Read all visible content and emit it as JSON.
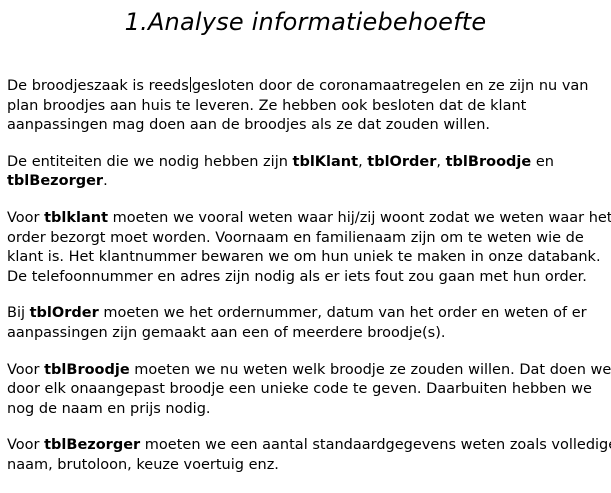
{
  "heading": "1.Analyse informatiebehoefte",
  "p1": {
    "l1_before_cursor": "De broodjeszaak is reeds",
    "l1_after_cursor": "gesloten door de coronamaatregelen en ze zijn nu van",
    "l2": "plan broodjes aan huis te leveren. Ze hebben ook besloten dat de klant",
    "l3": "aanpassingen mag doen aan de broodjes als ze dat zouden willen."
  },
  "p2": {
    "t1": "De entiteiten die we nodig hebben zijn ",
    "e1": "tblKlant",
    "t2": ", ",
    "e2": "tblOrder",
    "t3": ", ",
    "e3": "tblBroodje",
    "t4": " en",
    "e4": "tblBezorger",
    "t5": "."
  },
  "p3": {
    "t1": "Voor ",
    "e1": "tblklant",
    "t2": " moeten we vooral weten waar hij/zij woont zodat we weten waar het",
    "l2": "order bezorgt moet worden. Voornaam en familienaam zijn om te weten wie de",
    "l3": "klant is. Het klantnummer bewaren we om hun uniek te maken in onze databank.",
    "l4": "De telefoonnummer en adres zijn nodig als er iets fout zou gaan met hun order."
  },
  "p4": {
    "t1": "Bij ",
    "e1": "tblOrder",
    "t2": " moeten we het ordernummer, datum van het order en weten of er",
    "l2": "aanpassingen zijn gemaakt aan een of meerdere broodje(s)."
  },
  "p5": {
    "t1": "Voor ",
    "e1": "tblBroodje",
    "t2": " moeten we nu weten welk broodje ze zouden willen. Dat doen we",
    "l2": "door elk onaangepast broodje een unieke code te geven. Daarbuiten hebben we",
    "l3": "nog de naam en prijs nodig."
  },
  "p6": {
    "t1": "Voor ",
    "e1": "tblBezorger",
    "t2": " moeten we een aantal standaardgegevens weten zoals volledige",
    "l2": "naam, brutoloon, keuze voertuig enz."
  }
}
